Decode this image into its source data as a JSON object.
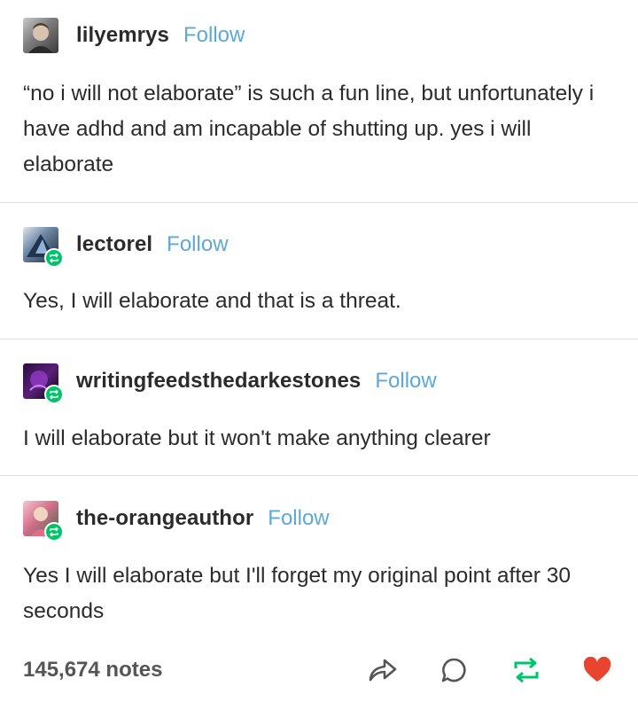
{
  "posts": [
    {
      "username": "lilyemrys",
      "follow_label": "Follow",
      "text": "“no i will not elaborate” is such a fun line, but unfortunately i have adhd and am incapable of shutting up. yes i will elaborate"
    },
    {
      "username": "lectorel",
      "follow_label": "Follow",
      "text": "Yes, I will elaborate and that is a threat."
    },
    {
      "username": "writingfeedsthedarkestones",
      "follow_label": "Follow",
      "text": "I will elaborate but it won't make anything clearer"
    },
    {
      "username": "the-orangeauthor",
      "follow_label": "Follow",
      "text": "Yes I will elaborate but I'll forget my original point after 30 seconds"
    }
  ],
  "footer": {
    "notes": "145,674 notes",
    "icons": [
      "share-icon",
      "reply-icon",
      "reblog-icon",
      "like-icon"
    ]
  },
  "colors": {
    "follow": "#5ea8d8",
    "reblog": "#00c46a",
    "like": "#e8442f",
    "text": "#2b2b2b"
  }
}
